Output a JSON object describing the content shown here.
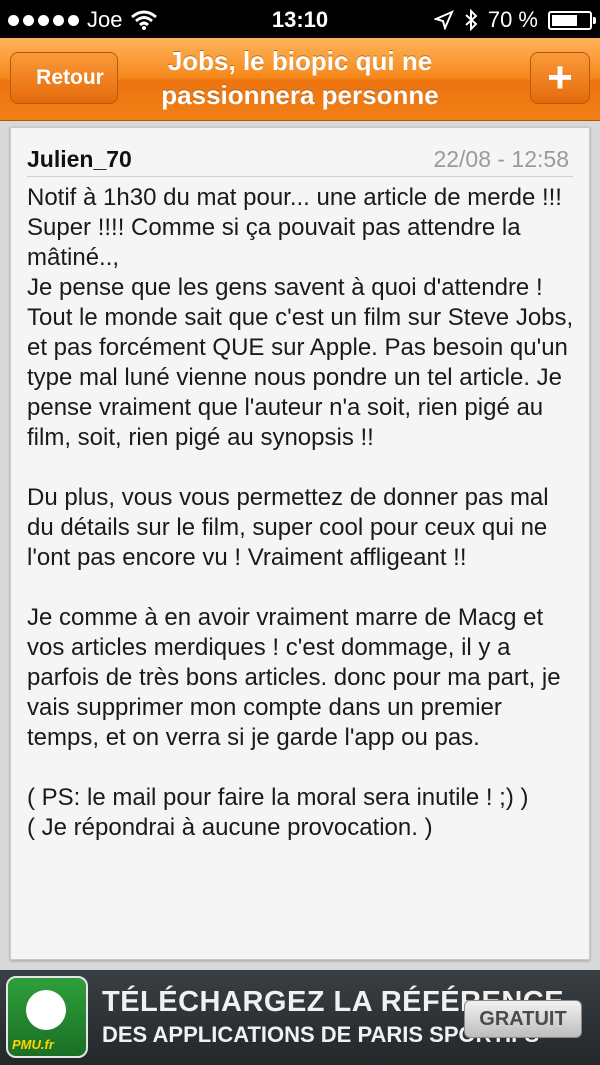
{
  "status_bar": {
    "carrier": "Joe",
    "time": "13:10",
    "battery_percent": "70 %",
    "battery_level": 0.7,
    "signal_bars": 5
  },
  "nav": {
    "back_label": "Retour",
    "title": "Jobs, le biopic qui ne passionnera personne",
    "add_label": "+"
  },
  "comment": {
    "author": "Julien_70",
    "date": "22/08 - 12:58",
    "paragraphs": [
      "Notif à 1h30 du mat pour... une article de merde !!! Super !!!! Comme si ça pouvait pas attendre la mâtiné..,\nJe pense que les gens savent à quoi d'attendre ! Tout le monde sait que c'est un film sur Steve Jobs, et pas forcément QUE sur Apple. Pas besoin qu'un type mal luné vienne nous pondre un tel article. Je pense vraiment que l'auteur n'a soit, rien pigé au film, soit, rien pigé au synopsis !!",
      "Du plus, vous vous permettez de donner pas mal du détails sur le film, super cool pour ceux qui ne l'ont pas encore vu ! Vraiment affligeant !!",
      "Je comme à en avoir vraiment marre de Macg et vos articles merdiques ! c'est dommage, il y a parfois de très bons articles. donc pour ma part, je vais supprimer mon compte dans un premier temps, et on verra si je garde l'app ou pas.",
      "( PS: le mail pour faire la moral sera inutile ! ;) )\n( Je répondrai à aucune provocation. )"
    ]
  },
  "ad": {
    "line1": "TÉLÉCHARGEZ LA RÉFÉRENCE",
    "line2": "DES APPLICATIONS DE PARIS SPORTIFS",
    "button": "GRATUIT",
    "logo_text": "PMU.fr"
  },
  "colors": {
    "nav_orange": "#f6891c",
    "button_orange": "#e46a0a",
    "card_bg": "#f5f5f5",
    "date_gray": "#9a9a9a"
  }
}
